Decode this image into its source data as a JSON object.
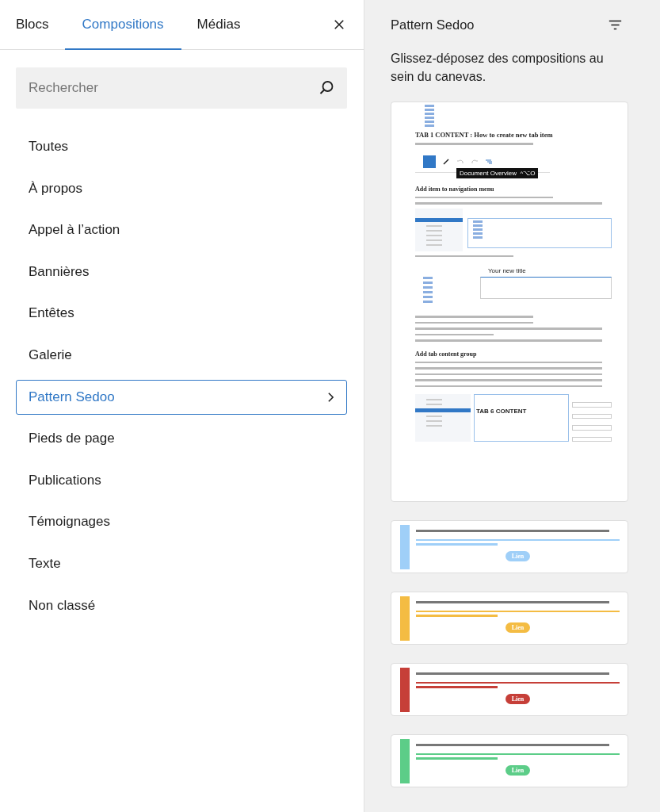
{
  "tabs": [
    {
      "label": "Blocs",
      "selected": false
    },
    {
      "label": "Compositions",
      "selected": true
    },
    {
      "label": "Médias",
      "selected": false
    }
  ],
  "search": {
    "placeholder": "Rechercher"
  },
  "categories": [
    {
      "label": "Toutes",
      "selected": false
    },
    {
      "label": "À propos",
      "selected": false
    },
    {
      "label": "Appel à l’action",
      "selected": false
    },
    {
      "label": "Bannières",
      "selected": false
    },
    {
      "label": "Entêtes",
      "selected": false
    },
    {
      "label": "Galerie",
      "selected": false
    },
    {
      "label": "Pattern Sedoo",
      "selected": true
    },
    {
      "label": "Pieds de page",
      "selected": false
    },
    {
      "label": "Publications",
      "selected": false
    },
    {
      "label": "Témoignages",
      "selected": false
    },
    {
      "label": "Texte",
      "selected": false
    },
    {
      "label": "Non classé",
      "selected": false
    }
  ],
  "panel": {
    "title": "Pattern Sedoo",
    "description": "Glissez-déposez des compositions au sein du canevas."
  },
  "patterns": [
    {
      "kind": "document",
      "heading": "TAB 1 CONTENT : How to create new tab item",
      "tooltip": "Document Overview  ^⌥O",
      "section_1": "Add item to navigation menu",
      "inset_title": "Your new title",
      "section_2": "Add tab content group",
      "inset_heading": "TAB 6 CONTENT"
    },
    {
      "kind": "callout",
      "color": "#9fcff8",
      "button": "Lien"
    },
    {
      "kind": "callout",
      "color": "#f4bc43",
      "button": "Lien"
    },
    {
      "kind": "callout",
      "color": "#c63f38",
      "button": "Lien"
    },
    {
      "kind": "callout",
      "color": "#5ccd88",
      "button": "Lien"
    }
  ]
}
